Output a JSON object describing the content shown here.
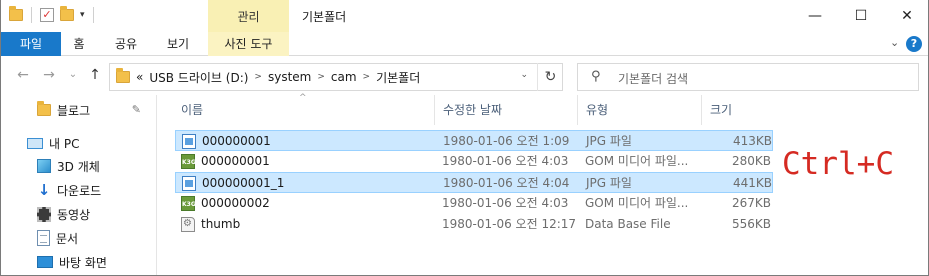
{
  "titlebar": {
    "context_group_label": "관리",
    "window_title": "기본폴더",
    "minimize": "—",
    "maximize": "☐",
    "close": "✕",
    "qat_dropdown": "▾"
  },
  "ribbon": {
    "tabs": [
      "파일",
      "홈",
      "공유",
      "보기"
    ],
    "context_tab": "사진 도구",
    "expand": "⌄",
    "help": "?"
  },
  "navigation": {
    "back": "←",
    "forward": "→",
    "recent": "⌄",
    "up": "↑",
    "overflow": "«",
    "breadcrumbs": [
      "USB 드라이브 (D:)",
      "system",
      "cam",
      "기본폴더"
    ],
    "address_dropdown": "⌄",
    "refresh": "↻",
    "search_placeholder": "기본폴더 검색"
  },
  "nav_pane": {
    "items": [
      {
        "label": "블로그",
        "icon": "folder-icon",
        "pinned": true
      },
      {
        "label": "내 PC",
        "icon": "pc-icon"
      },
      {
        "label": "3D 개체",
        "icon": "3d-objects-icon"
      },
      {
        "label": "다운로드",
        "icon": "download-icon"
      },
      {
        "label": "동영상",
        "icon": "video-icon"
      },
      {
        "label": "문서",
        "icon": "document-icon"
      },
      {
        "label": "바탕 화면",
        "icon": "desktop-icon"
      }
    ],
    "pin_glyph": "📌"
  },
  "file_list": {
    "sort_indicator": "^",
    "columns": [
      "이름",
      "수정한 날짜",
      "유형",
      "크기"
    ],
    "rows": [
      {
        "name": "000000001",
        "date": "1980-01-06 오전 1:09",
        "type": "JPG 파일",
        "size": "413KB",
        "icon": "jpg-file-icon",
        "selected": true
      },
      {
        "name": "000000001",
        "date": "1980-01-06 오전 4:03",
        "type": "GOM 미디어 파일...",
        "size": "280KB",
        "icon": "gom-file-icon",
        "selected": false
      },
      {
        "name": "000000001_1",
        "date": "1980-01-06 오전 4:04",
        "type": "JPG 파일",
        "size": "441KB",
        "icon": "jpg-file-icon",
        "selected": true
      },
      {
        "name": "000000002",
        "date": "1980-01-06 오전 4:03",
        "type": "GOM 미디어 파일...",
        "size": "267KB",
        "icon": "gom-file-icon",
        "selected": false
      },
      {
        "name": "thumb",
        "date": "1980-01-06 오전 12:17",
        "type": "Data Base File",
        "size": "556KB",
        "icon": "database-file-icon",
        "selected": false
      }
    ],
    "gom_badge": "K3G"
  },
  "annotation": "Ctrl+C",
  "colors": {
    "accent": "#1979ca",
    "selection": "#cce8ff",
    "context_tab": "#f9f0b4",
    "annotation": "#d52a22"
  }
}
